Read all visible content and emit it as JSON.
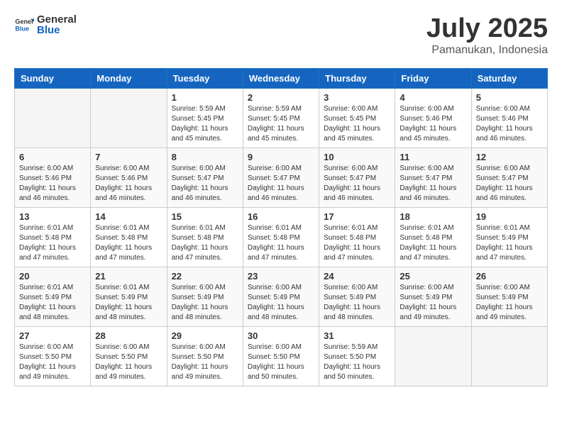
{
  "header": {
    "logo_general": "General",
    "logo_blue": "Blue",
    "month": "July 2025",
    "location": "Pamanukan, Indonesia"
  },
  "weekdays": [
    "Sunday",
    "Monday",
    "Tuesday",
    "Wednesday",
    "Thursday",
    "Friday",
    "Saturday"
  ],
  "weeks": [
    [
      {
        "day": "",
        "sunrise": "",
        "sunset": "",
        "daylight": ""
      },
      {
        "day": "",
        "sunrise": "",
        "sunset": "",
        "daylight": ""
      },
      {
        "day": "1",
        "sunrise": "Sunrise: 5:59 AM",
        "sunset": "Sunset: 5:45 PM",
        "daylight": "Daylight: 11 hours and 45 minutes."
      },
      {
        "day": "2",
        "sunrise": "Sunrise: 5:59 AM",
        "sunset": "Sunset: 5:45 PM",
        "daylight": "Daylight: 11 hours and 45 minutes."
      },
      {
        "day": "3",
        "sunrise": "Sunrise: 6:00 AM",
        "sunset": "Sunset: 5:45 PM",
        "daylight": "Daylight: 11 hours and 45 minutes."
      },
      {
        "day": "4",
        "sunrise": "Sunrise: 6:00 AM",
        "sunset": "Sunset: 5:46 PM",
        "daylight": "Daylight: 11 hours and 45 minutes."
      },
      {
        "day": "5",
        "sunrise": "Sunrise: 6:00 AM",
        "sunset": "Sunset: 5:46 PM",
        "daylight": "Daylight: 11 hours and 46 minutes."
      }
    ],
    [
      {
        "day": "6",
        "sunrise": "Sunrise: 6:00 AM",
        "sunset": "Sunset: 5:46 PM",
        "daylight": "Daylight: 11 hours and 46 minutes."
      },
      {
        "day": "7",
        "sunrise": "Sunrise: 6:00 AM",
        "sunset": "Sunset: 5:46 PM",
        "daylight": "Daylight: 11 hours and 46 minutes."
      },
      {
        "day": "8",
        "sunrise": "Sunrise: 6:00 AM",
        "sunset": "Sunset: 5:47 PM",
        "daylight": "Daylight: 11 hours and 46 minutes."
      },
      {
        "day": "9",
        "sunrise": "Sunrise: 6:00 AM",
        "sunset": "Sunset: 5:47 PM",
        "daylight": "Daylight: 11 hours and 46 minutes."
      },
      {
        "day": "10",
        "sunrise": "Sunrise: 6:00 AM",
        "sunset": "Sunset: 5:47 PM",
        "daylight": "Daylight: 11 hours and 46 minutes."
      },
      {
        "day": "11",
        "sunrise": "Sunrise: 6:00 AM",
        "sunset": "Sunset: 5:47 PM",
        "daylight": "Daylight: 11 hours and 46 minutes."
      },
      {
        "day": "12",
        "sunrise": "Sunrise: 6:00 AM",
        "sunset": "Sunset: 5:47 PM",
        "daylight": "Daylight: 11 hours and 46 minutes."
      }
    ],
    [
      {
        "day": "13",
        "sunrise": "Sunrise: 6:01 AM",
        "sunset": "Sunset: 5:48 PM",
        "daylight": "Daylight: 11 hours and 47 minutes."
      },
      {
        "day": "14",
        "sunrise": "Sunrise: 6:01 AM",
        "sunset": "Sunset: 5:48 PM",
        "daylight": "Daylight: 11 hours and 47 minutes."
      },
      {
        "day": "15",
        "sunrise": "Sunrise: 6:01 AM",
        "sunset": "Sunset: 5:48 PM",
        "daylight": "Daylight: 11 hours and 47 minutes."
      },
      {
        "day": "16",
        "sunrise": "Sunrise: 6:01 AM",
        "sunset": "Sunset: 5:48 PM",
        "daylight": "Daylight: 11 hours and 47 minutes."
      },
      {
        "day": "17",
        "sunrise": "Sunrise: 6:01 AM",
        "sunset": "Sunset: 5:48 PM",
        "daylight": "Daylight: 11 hours and 47 minutes."
      },
      {
        "day": "18",
        "sunrise": "Sunrise: 6:01 AM",
        "sunset": "Sunset: 5:48 PM",
        "daylight": "Daylight: 11 hours and 47 minutes."
      },
      {
        "day": "19",
        "sunrise": "Sunrise: 6:01 AM",
        "sunset": "Sunset: 5:49 PM",
        "daylight": "Daylight: 11 hours and 47 minutes."
      }
    ],
    [
      {
        "day": "20",
        "sunrise": "Sunrise: 6:01 AM",
        "sunset": "Sunset: 5:49 PM",
        "daylight": "Daylight: 11 hours and 48 minutes."
      },
      {
        "day": "21",
        "sunrise": "Sunrise: 6:01 AM",
        "sunset": "Sunset: 5:49 PM",
        "daylight": "Daylight: 11 hours and 48 minutes."
      },
      {
        "day": "22",
        "sunrise": "Sunrise: 6:00 AM",
        "sunset": "Sunset: 5:49 PM",
        "daylight": "Daylight: 11 hours and 48 minutes."
      },
      {
        "day": "23",
        "sunrise": "Sunrise: 6:00 AM",
        "sunset": "Sunset: 5:49 PM",
        "daylight": "Daylight: 11 hours and 48 minutes."
      },
      {
        "day": "24",
        "sunrise": "Sunrise: 6:00 AM",
        "sunset": "Sunset: 5:49 PM",
        "daylight": "Daylight: 11 hours and 48 minutes."
      },
      {
        "day": "25",
        "sunrise": "Sunrise: 6:00 AM",
        "sunset": "Sunset: 5:49 PM",
        "daylight": "Daylight: 11 hours and 49 minutes."
      },
      {
        "day": "26",
        "sunrise": "Sunrise: 6:00 AM",
        "sunset": "Sunset: 5:49 PM",
        "daylight": "Daylight: 11 hours and 49 minutes."
      }
    ],
    [
      {
        "day": "27",
        "sunrise": "Sunrise: 6:00 AM",
        "sunset": "Sunset: 5:50 PM",
        "daylight": "Daylight: 11 hours and 49 minutes."
      },
      {
        "day": "28",
        "sunrise": "Sunrise: 6:00 AM",
        "sunset": "Sunset: 5:50 PM",
        "daylight": "Daylight: 11 hours and 49 minutes."
      },
      {
        "day": "29",
        "sunrise": "Sunrise: 6:00 AM",
        "sunset": "Sunset: 5:50 PM",
        "daylight": "Daylight: 11 hours and 49 minutes."
      },
      {
        "day": "30",
        "sunrise": "Sunrise: 6:00 AM",
        "sunset": "Sunset: 5:50 PM",
        "daylight": "Daylight: 11 hours and 50 minutes."
      },
      {
        "day": "31",
        "sunrise": "Sunrise: 5:59 AM",
        "sunset": "Sunset: 5:50 PM",
        "daylight": "Daylight: 11 hours and 50 minutes."
      },
      {
        "day": "",
        "sunrise": "",
        "sunset": "",
        "daylight": ""
      },
      {
        "day": "",
        "sunrise": "",
        "sunset": "",
        "daylight": ""
      }
    ]
  ]
}
